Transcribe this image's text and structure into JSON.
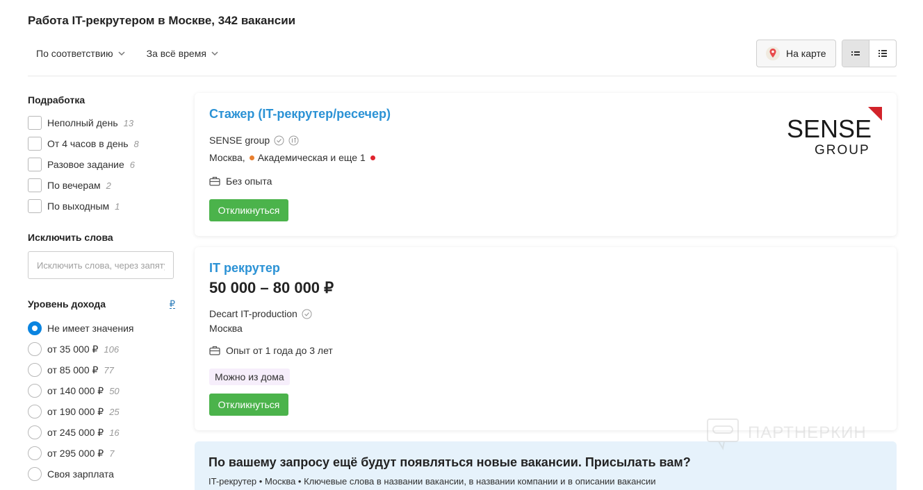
{
  "page": {
    "title": "Работа IT-рекрутером в Москве, 342 вакансии"
  },
  "sort": {
    "relevance": "По соответствию",
    "period": "За всё время"
  },
  "toolbar": {
    "map_label": "На карте"
  },
  "filters": {
    "parttime": {
      "heading": "Подработка",
      "items": [
        {
          "label": "Неполный день",
          "count": "13"
        },
        {
          "label": "От 4 часов в день",
          "count": "8"
        },
        {
          "label": "Разовое задание",
          "count": "6"
        },
        {
          "label": "По вечерам",
          "count": "2"
        },
        {
          "label": "По выходным",
          "count": "1"
        }
      ]
    },
    "exclude": {
      "heading": "Исключить слова",
      "placeholder": "Исключить слова, через запятую"
    },
    "income": {
      "heading": "Уровень дохода",
      "currency": "₽",
      "selected_index": 0,
      "items": [
        {
          "label": "Не имеет значения",
          "count": ""
        },
        {
          "label": "от 35 000 ₽",
          "count": "106"
        },
        {
          "label": "от 85 000 ₽",
          "count": "77"
        },
        {
          "label": "от 140 000 ₽",
          "count": "50"
        },
        {
          "label": "от 190 000 ₽",
          "count": "25"
        },
        {
          "label": "от 245 000 ₽",
          "count": "16"
        },
        {
          "label": "от 295 000 ₽",
          "count": "7"
        },
        {
          "label": "Своя зарплата",
          "count": ""
        }
      ]
    }
  },
  "vacancies": [
    {
      "title": "Стажер (IT-рекрутер/ресечер)",
      "company": "SENSE group",
      "city": "Москва,",
      "metro": "Академическая и еще 1",
      "metro_color": "#e87f2f",
      "metro_color_2": "#e0242e",
      "experience": "Без опыта",
      "respond": "Откликнуться",
      "logo_line1": "SENSE",
      "logo_line2": "GROUP"
    },
    {
      "title": "IT рекрутер",
      "salary": "50 000 – 80 000 ₽",
      "company": "Decart IT-production",
      "city": "Москва",
      "experience": "Опыт от 1 года до 3 лет",
      "tag": "Можно из дома",
      "respond": "Откликнуться"
    }
  ],
  "subscribe": {
    "title": "По вашему запросу ещё будут появляться новые вакансии. Присылать вам?",
    "subtitle": "IT-рекрутер • Москва • Ключевые слова в названии вакансии, в названии компании и в описании вакансии"
  },
  "watermark": "ПАРТНЕРКИН",
  "colors": {
    "link": "#2b92d5",
    "button": "#4bb34b",
    "radio_checked": "#0a84e0"
  }
}
